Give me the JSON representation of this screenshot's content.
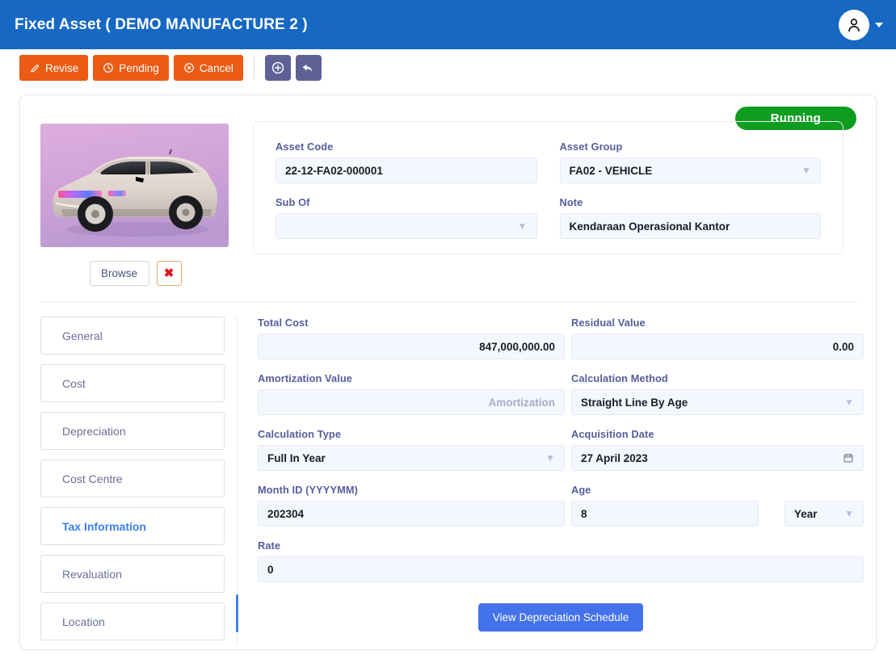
{
  "header": {
    "title": "Fixed Asset ( DEMO MANUFACTURE 2 )",
    "avatar_icon": "user-icon",
    "caret_icon": "caret-down-icon",
    "bg_color": "#1668c3"
  },
  "toolbar": {
    "buttons": [
      {
        "label": "Revise",
        "icon": "edit-pencil-icon",
        "color": "#ec5b14"
      },
      {
        "label": "Pending",
        "icon": "clock-icon",
        "color": "#ec5b14"
      },
      {
        "label": "Cancel",
        "icon": "circle-x-icon",
        "color": "#ec5b14"
      }
    ],
    "icon_buttons": [
      {
        "icon": "circle-plus-icon",
        "color": "#5d6196"
      },
      {
        "icon": "undo-arrow-icon",
        "color": "#5d6196"
      }
    ]
  },
  "status": {
    "label": "Running",
    "color": "#0f9d20"
  },
  "photo": {
    "alt": "asset-photo-vehicle",
    "browse_label": "Browse",
    "delete_label": "✖"
  },
  "info": {
    "asset_code": {
      "label": "Asset Code",
      "value": "22-12-FA02-000001"
    },
    "asset_group": {
      "label": "Asset Group",
      "value": "FA02 - VEHICLE"
    },
    "sub_of": {
      "label": "Sub Of",
      "value": ""
    },
    "note": {
      "label": "Note",
      "value": "Kendaraan Operasional Kantor"
    }
  },
  "tabs": [
    {
      "label": "General",
      "active": false
    },
    {
      "label": "Cost",
      "active": false
    },
    {
      "label": "Depreciation",
      "active": false
    },
    {
      "label": "Cost Centre",
      "active": false
    },
    {
      "label": "Tax Information",
      "active": true
    },
    {
      "label": "Revaluation",
      "active": false
    },
    {
      "label": "Location",
      "active": false
    }
  ],
  "form": {
    "total_cost": {
      "label": "Total Cost",
      "value": "847,000,000.00"
    },
    "residual_value": {
      "label": "Residual Value",
      "value": "0.00"
    },
    "amortization_value": {
      "label": "Amortization Value",
      "placeholder": "Amortization",
      "value": ""
    },
    "calculation_method": {
      "label": "Calculation Method",
      "value": "Straight Line By Age"
    },
    "calculation_type": {
      "label": "Calculation Type",
      "value": "Full In Year"
    },
    "acquisition_date": {
      "label": "Acquisition Date",
      "value": "27 April 2023",
      "icon": "calendar-icon"
    },
    "month_id": {
      "label": "Month ID (YYYYMM)",
      "value": "202304"
    },
    "age": {
      "label": "Age",
      "value": "8"
    },
    "age_unit": {
      "value": "Year"
    },
    "rate": {
      "label": "Rate",
      "value": "0"
    },
    "submit_label": "View Depreciation Schedule"
  }
}
